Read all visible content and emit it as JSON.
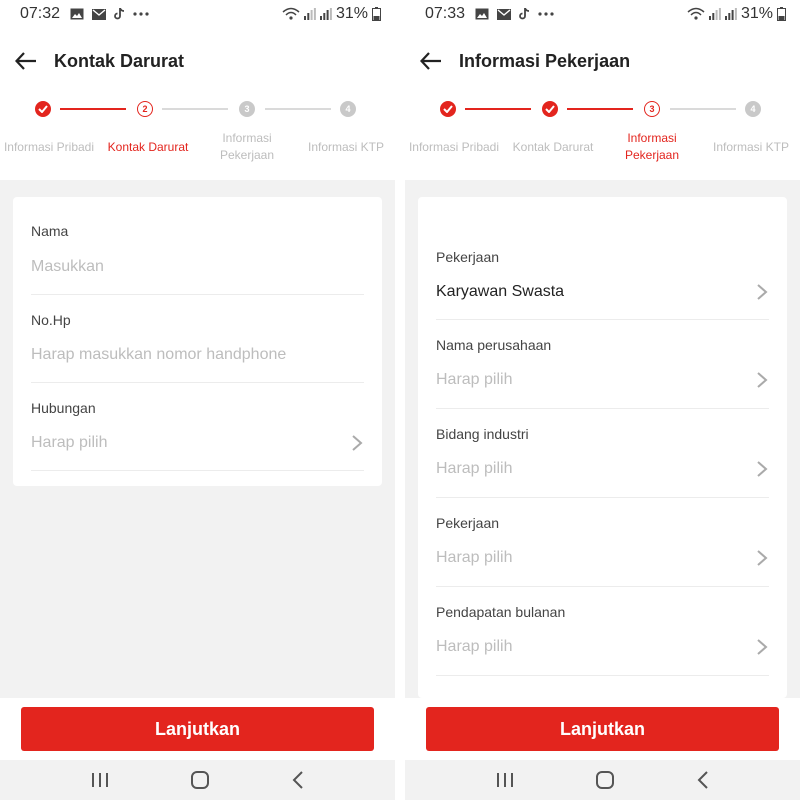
{
  "left": {
    "status": {
      "time": "07:32",
      "battery": "31%"
    },
    "title": "Kontak Darurat",
    "steps": [
      {
        "num": "",
        "label": "Informasi Pribadi",
        "state": "done"
      },
      {
        "num": "2",
        "label": "Kontak Darurat",
        "state": "active"
      },
      {
        "num": "3",
        "label": "Informasi Pekerjaan",
        "state": "pending"
      },
      {
        "num": "4",
        "label": "Informasi KTP",
        "state": "pending"
      }
    ],
    "fields": [
      {
        "label": "Nama",
        "placeholder": "Masukkan",
        "has_chevron": false
      },
      {
        "label": "No.Hp",
        "placeholder": "Harap masukkan nomor handphone",
        "has_chevron": false
      },
      {
        "label": "Hubungan",
        "placeholder": "Harap pilih",
        "has_chevron": true
      }
    ],
    "button": "Lanjutkan"
  },
  "right": {
    "status": {
      "time": "07:33",
      "battery": "31%"
    },
    "title": "Informasi Pekerjaan",
    "steps": [
      {
        "num": "",
        "label": "Informasi Pribadi",
        "state": "done"
      },
      {
        "num": "",
        "label": "Kontak Darurat",
        "state": "done"
      },
      {
        "num": "3",
        "label": "Informasi Pekerjaan",
        "state": "active"
      },
      {
        "num": "4",
        "label": "Informasi KTP",
        "state": "pending"
      }
    ],
    "fields": [
      {
        "label": "Pekerjaan",
        "value": "Karyawan Swasta",
        "has_chevron": true
      },
      {
        "label": "Nama perusahaan",
        "placeholder": "Harap pilih",
        "has_chevron": true
      },
      {
        "label": "Bidang industri",
        "placeholder": "Harap pilih",
        "has_chevron": true
      },
      {
        "label": "Pekerjaan",
        "placeholder": "Harap pilih",
        "has_chevron": true
      },
      {
        "label": "Pendapatan bulanan",
        "placeholder": "Harap pilih",
        "has_chevron": true
      }
    ],
    "button": "Lanjutkan"
  },
  "colors": {
    "accent": "#e3251e",
    "pending": "#c9c9c9",
    "placeholder": "#bdbdbd"
  },
  "icons": {
    "status_left": [
      "gallery-icon",
      "mail-icon",
      "tiktok-icon",
      "more-icon"
    ],
    "status_right": [
      "wifi-icon",
      "signal-icon",
      "signal-icon",
      "battery-icon"
    ],
    "nav": [
      "recent-apps-icon",
      "home-icon",
      "back-nav-icon"
    ]
  }
}
